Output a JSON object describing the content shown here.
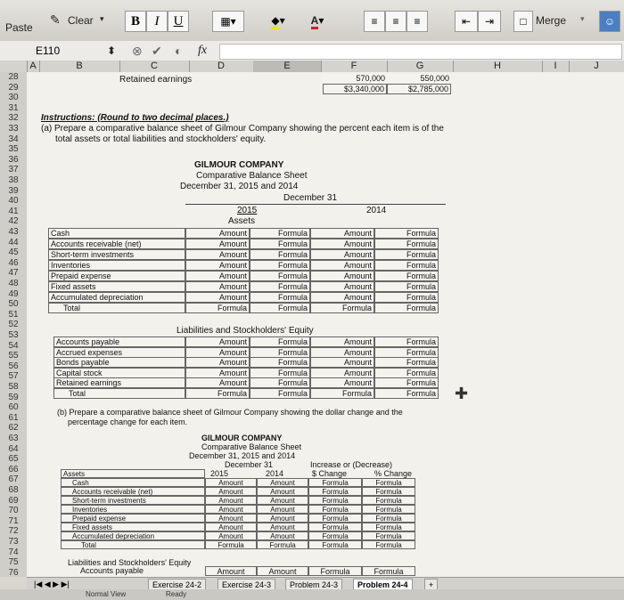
{
  "ribbon": {
    "paste_label": "Paste",
    "clear_label": "Clear",
    "bold": "B",
    "italic": "I",
    "underline": "U",
    "merge_label": "Merge",
    "fill_letter": "A",
    "colors": {
      "font_red": "#cc2222",
      "fill_yellow": "#f2e200"
    }
  },
  "formula_bar": {
    "name_box": "E110",
    "fx": "fx"
  },
  "columns": [
    "A",
    "B",
    "C",
    "D",
    "E",
    "F",
    "G",
    "H",
    "I",
    "J"
  ],
  "rows": [
    "28",
    "29",
    "30",
    "31",
    "32",
    "33",
    "34",
    "35",
    "36",
    "37",
    "38",
    "39",
    "40",
    "41",
    "42",
    "43",
    "44",
    "45",
    "46",
    "47",
    "48",
    "49",
    "50",
    "51",
    "52",
    "53",
    "54",
    "55",
    "56",
    "57",
    "58",
    "59",
    "60",
    "61",
    "62",
    "63",
    "64",
    "65",
    "66",
    "67",
    "68",
    "69",
    "70",
    "71",
    "72",
    "73",
    "74",
    "75",
    "76"
  ],
  "top": {
    "retained": "Retained earnings",
    "f28": "570,000",
    "g28": "550,000",
    "f29": "$3,340,000",
    "g29": "$2,785,000"
  },
  "instructions": {
    "title": "Instructions: (Round to two decimal places.)",
    "a_line1": "(a) Prepare a comparative balance sheet of Gilmour Company showing the percent each item is of the",
    "a_line2": "total assets or total liabilities and stockholders' equity.",
    "b_line1": "(b) Prepare a comparative balance sheet of Gilmour Company showing the dollar change and the",
    "b_line2": "percentage change for each item."
  },
  "sheet1": {
    "company": "GILMOUR COMPANY",
    "title": "Comparative Balance Sheet",
    "date": "December 31, 2015 and 2014",
    "dec31": "December 31",
    "y2015": "2015",
    "y2014": "2014",
    "assets": "Assets",
    "amount": "Amount",
    "formula": "Formula",
    "asset_items": [
      "Cash",
      "Accounts receivable (net)",
      "Short-term investments",
      "Inventories",
      "Prepaid expense",
      "Fixed assets",
      "Accumulated depreciation",
      "Total"
    ],
    "liab_header": "Liabilities and Stockholders' Equity",
    "liab_items": [
      "Accounts payable",
      "Accrued expenses",
      "Bonds payable",
      "Capital stock",
      "Retained earnings",
      "Total"
    ]
  },
  "sheet2": {
    "company": "GILMOUR COMPANY",
    "title": "Comparative Balance Sheet",
    "date": "December 31, 2015 and 2014",
    "dec31": "December 31",
    "y2015": "2015",
    "y2014": "2014",
    "incdec": "Increase or (Decrease)",
    "schange": "$ Change",
    "pchange": "% Change",
    "assets": "Assets",
    "amount": "Amount",
    "formula": "Formula",
    "asset_items": [
      "Cash",
      "Accounts receivable (net)",
      "Short-term investments",
      "Inventories",
      "Prepaid expense",
      "Fixed assets",
      "Accumulated depreciation",
      "Total"
    ],
    "liab_header": "Liabilities and Stockholders' Equity",
    "liab_first": "Accounts payable"
  },
  "tabs": [
    "Exercise 24-2",
    "Exercise 24-3",
    "Problem 24-3",
    "Problem 24-4"
  ],
  "status": {
    "view": "Normal View",
    "ready": "Ready"
  }
}
